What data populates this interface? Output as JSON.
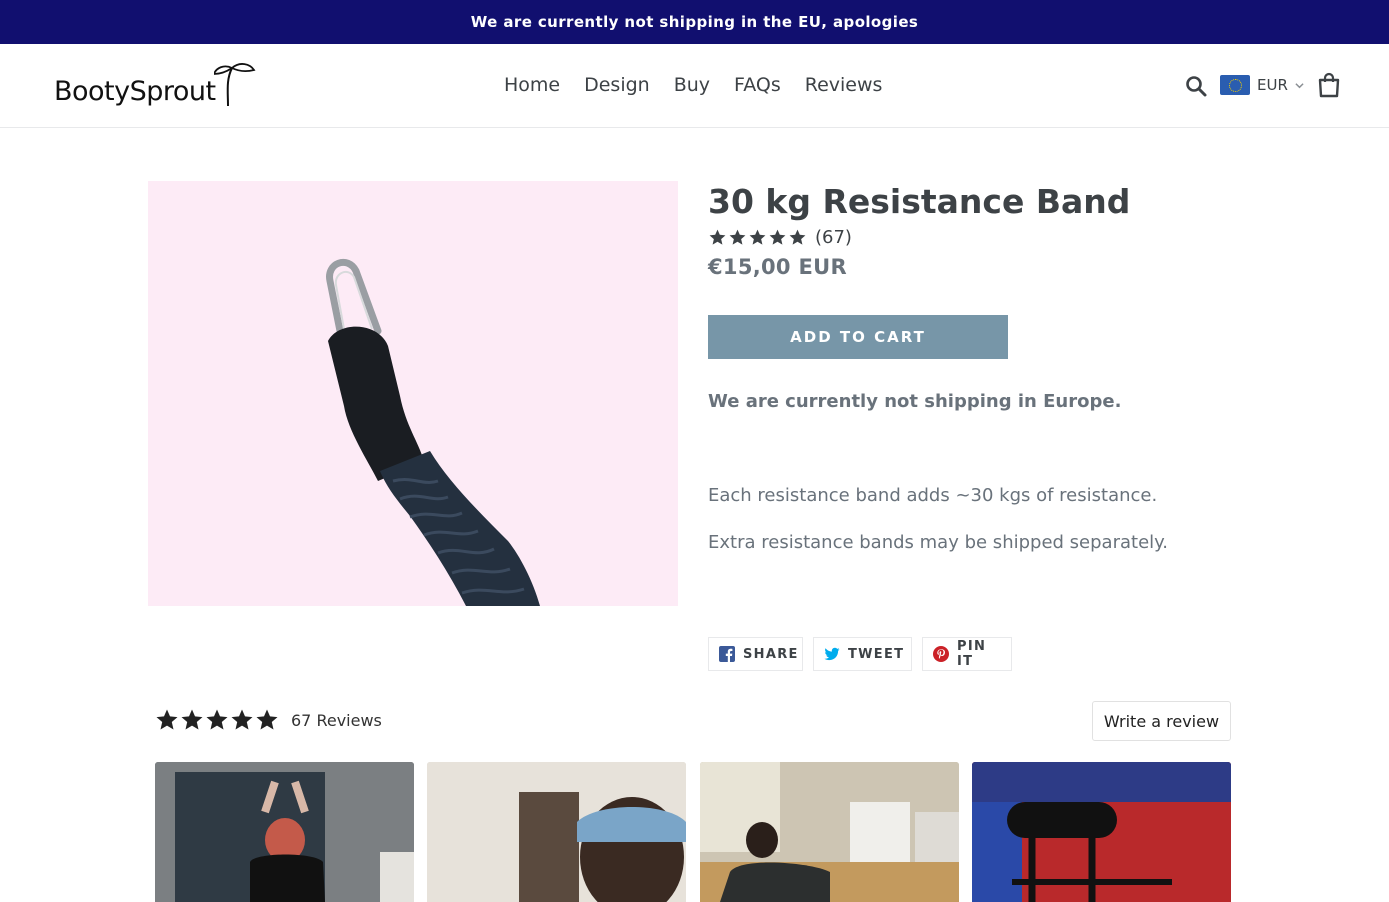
{
  "announcement": {
    "text": "We are currently not shipping in the EU, apologies"
  },
  "header": {
    "logo_text": "BootySprout",
    "nav": [
      {
        "label": "Home"
      },
      {
        "label": "Design"
      },
      {
        "label": "Buy"
      },
      {
        "label": "FAQs"
      },
      {
        "label": "Reviews"
      }
    ],
    "currency": {
      "code": "EUR",
      "flag": "eu-flag-icon"
    },
    "icons": [
      "search-icon",
      "chevron-down-icon",
      "cart-icon"
    ]
  },
  "product": {
    "title": "30 kg Resistance Band",
    "rating": {
      "stars": 5,
      "count": "(67)"
    },
    "price": "€15,00 EUR",
    "add_to_cart": "ADD TO CART",
    "notice": "We are currently not shipping in Europe.",
    "description": [
      "Each resistance band adds ~30 kgs of resistance.",
      "Extra resistance bands may be shipped separately."
    ],
    "image_background": "#fdebf6"
  },
  "share": {
    "facebook": "SHARE",
    "twitter": "TWEET",
    "pinterest": "PIN IT"
  },
  "reviews": {
    "stars": 5,
    "count_label": "67 Reviews",
    "write_review": "Write a review",
    "photos": [
      "review-photo-1",
      "review-photo-2",
      "review-photo-3",
      "review-photo-4"
    ]
  },
  "colors": {
    "announcement_bg": "#110f6f",
    "button_bg": "#7796a8",
    "text": "#3d4246",
    "muted_text": "#69727b",
    "facebook": "#3b5998",
    "twitter": "#00aced",
    "pinterest": "#cb2127"
  }
}
